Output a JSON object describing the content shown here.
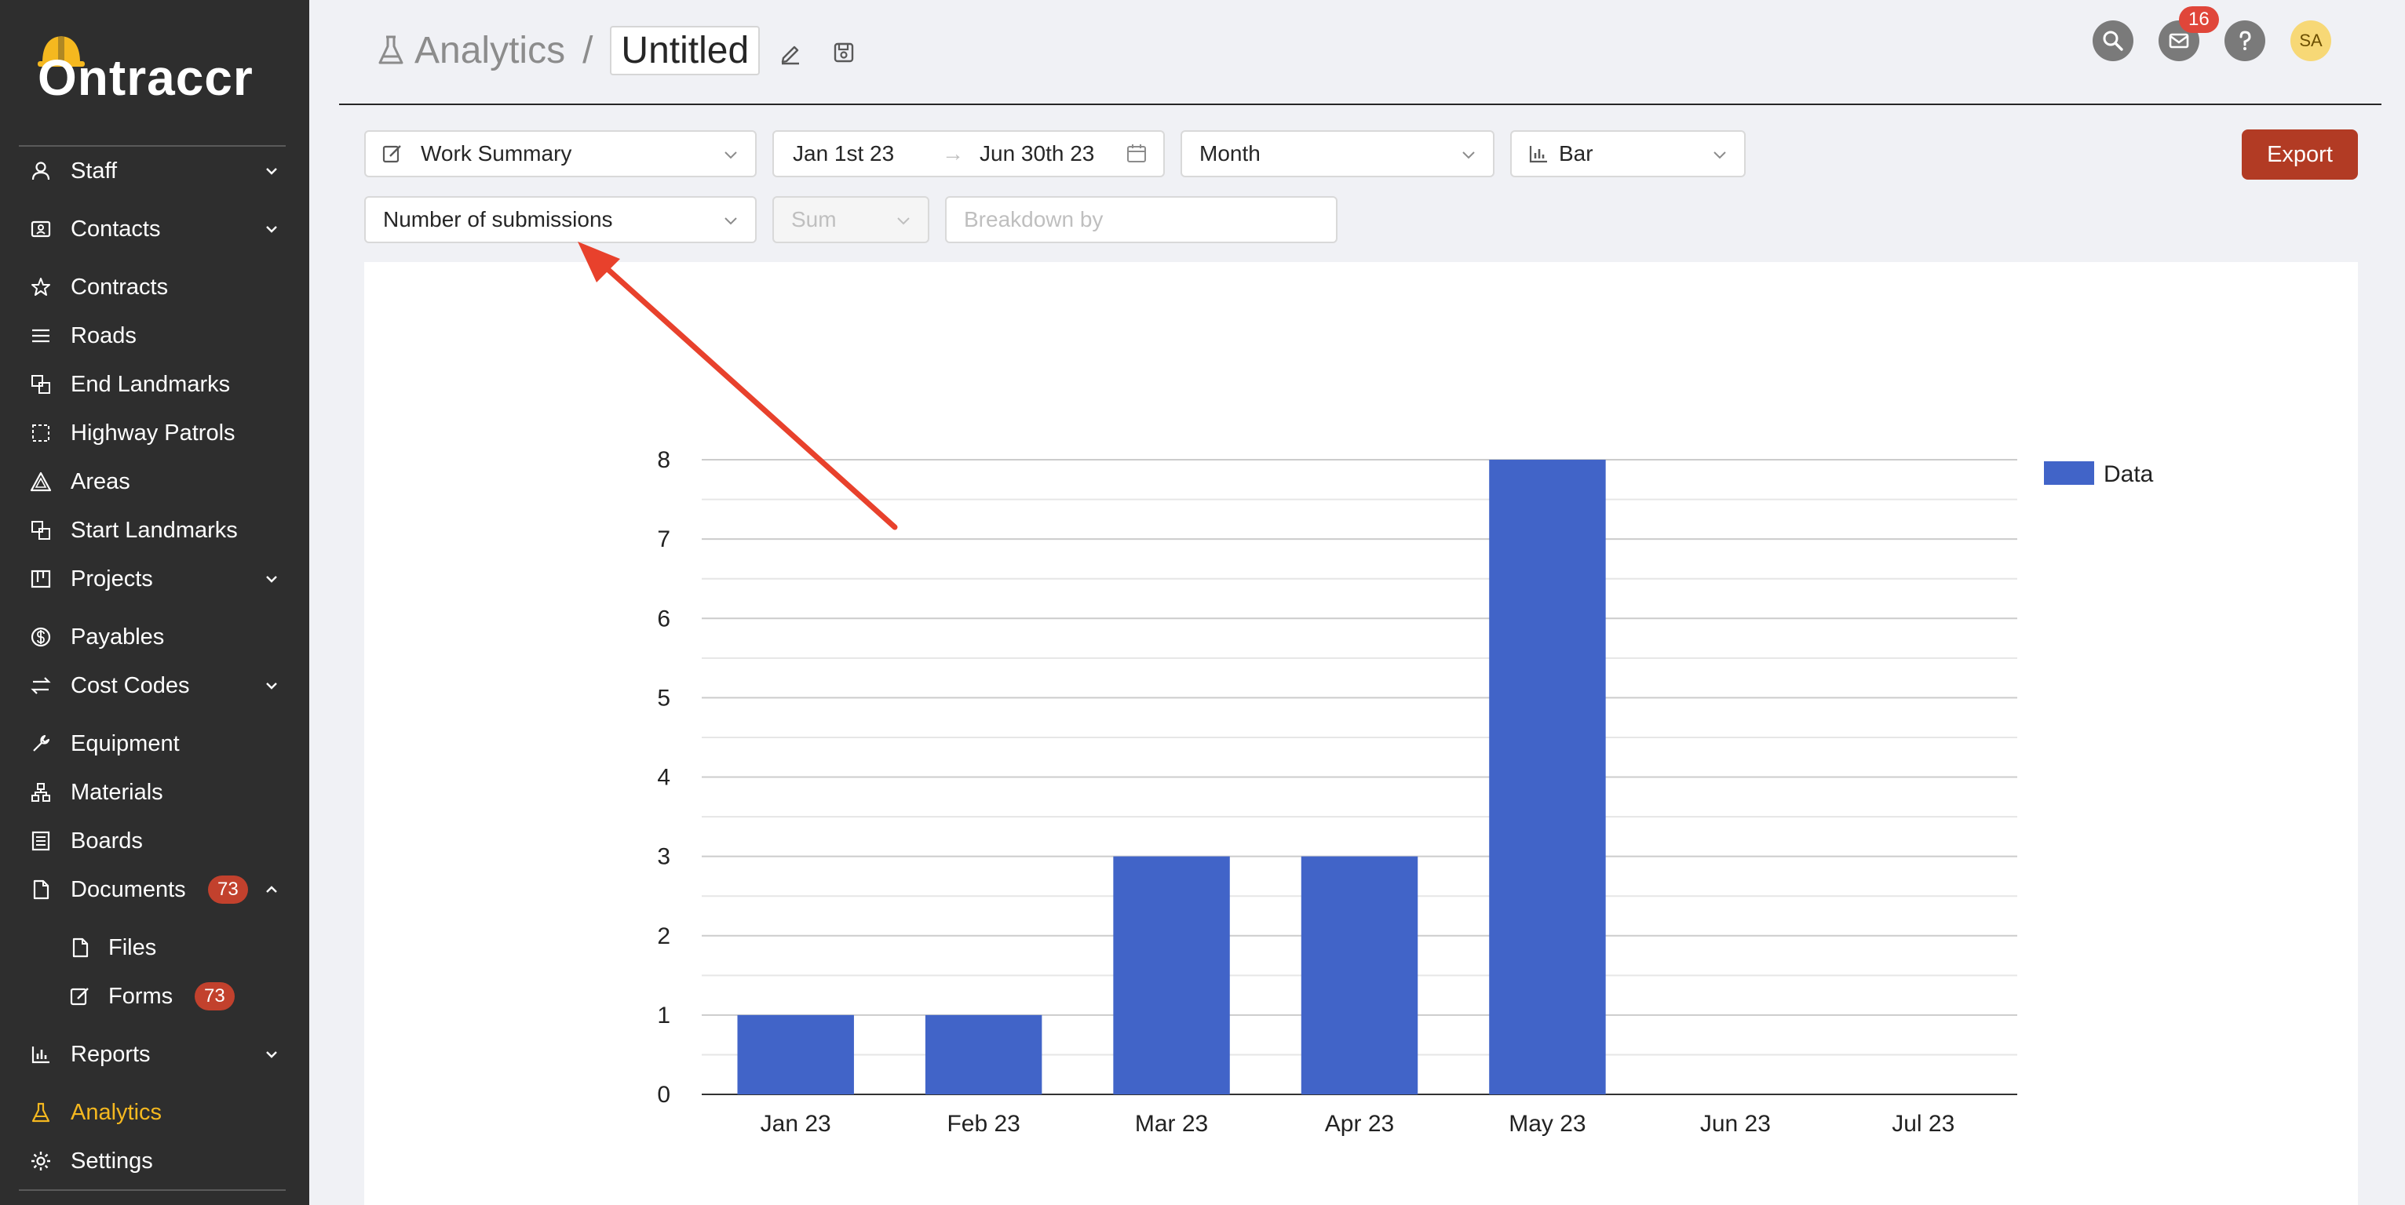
{
  "app": {
    "logo_text": "Ontraccr"
  },
  "sidebar": {
    "items": [
      {
        "label": "Staff",
        "icon": "user-icon",
        "chevron": "down"
      },
      {
        "label": "Contacts",
        "icon": "contacts-icon",
        "chevron": "down"
      },
      {
        "label": "Contracts",
        "icon": "star-icon"
      },
      {
        "label": "Roads",
        "icon": "roads-icon"
      },
      {
        "label": "End Landmarks",
        "icon": "landmark-icon"
      },
      {
        "label": "Highway Patrols",
        "icon": "patrol-icon"
      },
      {
        "label": "Areas",
        "icon": "areas-icon"
      },
      {
        "label": "Start Landmarks",
        "icon": "landmark-icon"
      },
      {
        "label": "Projects",
        "icon": "projects-icon",
        "chevron": "down"
      },
      {
        "label": "Payables",
        "icon": "dollar-icon"
      },
      {
        "label": "Cost Codes",
        "icon": "swap-icon",
        "chevron": "down"
      },
      {
        "label": "Equipment",
        "icon": "wrench-icon"
      },
      {
        "label": "Materials",
        "icon": "materials-icon"
      },
      {
        "label": "Boards",
        "icon": "boards-icon"
      },
      {
        "label": "Documents",
        "icon": "document-icon",
        "badge": "73",
        "chevron": "up"
      },
      {
        "label": "Files",
        "icon": "file-icon"
      },
      {
        "label": "Forms",
        "icon": "form-icon",
        "badge": "73"
      },
      {
        "label": "Reports",
        "icon": "bar-chart-icon",
        "chevron": "down"
      },
      {
        "label": "Analytics",
        "icon": "flask-icon",
        "active": true
      },
      {
        "label": "Settings",
        "icon": "gear-icon"
      }
    ]
  },
  "header": {
    "parent": "Analytics",
    "separator": "/",
    "title": "Untitled",
    "inbox_count": "16",
    "avatar_initials": "SA"
  },
  "controls": {
    "report_type": "Work Summary",
    "date_start": "Jan 1st 23",
    "date_end": "Jun 30th 23",
    "date_arrow": "→",
    "interval": "Month",
    "chart_type": "Bar",
    "field": "Number of submissions",
    "aggregate": "Sum",
    "breakdown_placeholder": "Breakdown by",
    "export_label": "Export"
  },
  "colors": {
    "bar": "#4164c8",
    "accent": "#f5b81f",
    "export": "#b23b24",
    "annotation_arrow": "#e8412c"
  },
  "chart_data": {
    "type": "bar",
    "categories": [
      "Jan 23",
      "Feb 23",
      "Mar 23",
      "Apr 23",
      "May 23",
      "Jun 23",
      "Jul 23"
    ],
    "series": [
      {
        "name": "Data",
        "values": [
          1,
          1,
          3,
          3,
          8,
          0,
          0
        ]
      }
    ],
    "y_ticks": [
      "0",
      "1",
      "2",
      "3",
      "4",
      "5",
      "6",
      "7",
      "8"
    ],
    "ylim": [
      0,
      8
    ],
    "grid": true,
    "legend_position": "top-right"
  }
}
